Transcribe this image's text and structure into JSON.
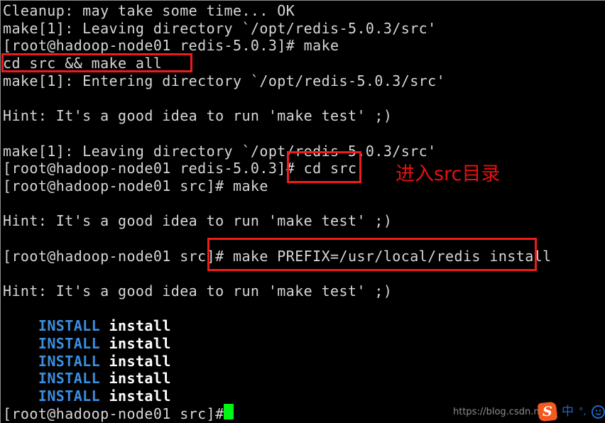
{
  "terminal": {
    "lines": [
      {
        "id": "line-cleanup",
        "text": "Cleanup: may take some time... OK"
      },
      {
        "id": "line-leaving-1",
        "text": "make[1]: Leaving directory `/opt/redis-5.0.3/src'"
      },
      {
        "id": "line-prompt-make",
        "text": "[root@hadoop-node01 redis-5.0.3]# make"
      },
      {
        "id": "line-cd-src-make-all",
        "text": "cd src && make all"
      },
      {
        "id": "line-entering-1",
        "text": "make[1]: Entering directory `/opt/redis-5.0.3/src'"
      },
      {
        "id": "line-blank-1",
        "text": ""
      },
      {
        "id": "line-hint-1",
        "text": "Hint: It's a good idea to run 'make test' ;)"
      },
      {
        "id": "line-blank-2",
        "text": ""
      },
      {
        "id": "line-leaving-2",
        "text": "make[1]: Leaving directory `/opt/redis-5.0.3/src'"
      },
      {
        "id": "line-prompt-cd-src",
        "text": "[root@hadoop-node01 redis-5.0.3]# cd src"
      },
      {
        "id": "line-prompt-make-2",
        "text": "[root@hadoop-node01 src]# make"
      },
      {
        "id": "line-blank-3",
        "text": ""
      },
      {
        "id": "line-hint-2",
        "text": "Hint: It's a good idea to run 'make test' ;)"
      },
      {
        "id": "line-blank-4",
        "text": ""
      },
      {
        "id": "line-prompt-install",
        "text": "[root@hadoop-node01 src]# make PREFIX=/usr/local/redis install"
      },
      {
        "id": "line-blank-5",
        "text": ""
      },
      {
        "id": "line-hint-3",
        "text": "Hint: It's a good idea to run 'make test' ;)"
      },
      {
        "id": "line-blank-6",
        "text": ""
      }
    ],
    "install_lines": [
      {
        "id": "install-line-1",
        "indent": "    ",
        "keyword": "INSTALL",
        "target": " install"
      },
      {
        "id": "install-line-2",
        "indent": "    ",
        "keyword": "INSTALL",
        "target": " install"
      },
      {
        "id": "install-line-3",
        "indent": "    ",
        "keyword": "INSTALL",
        "target": " install"
      },
      {
        "id": "install-line-4",
        "indent": "    ",
        "keyword": "INSTALL",
        "target": " install"
      },
      {
        "id": "install-line-5",
        "indent": "    ",
        "keyword": "INSTALL",
        "target": " install"
      }
    ],
    "final_prompt": "[root@hadoop-node01 src]# ",
    "colors": {
      "background": "#000000",
      "foreground": "#d6d6d6",
      "install_keyword": "#3a8fe0",
      "install_target": "#ffffff",
      "cursor": "#00f516",
      "annotation": "#ef1b1b"
    }
  },
  "annotations": {
    "box_cd_src_make_all_label": "cd src && make all",
    "box_cd_src_label": "cd src",
    "box_make_prefix_label": "make PREFIX=/usr/local/redis install",
    "note_enter_src_dir": "进入src目录"
  },
  "watermark": {
    "url": "https://blog.csdn.net/"
  },
  "ime": {
    "logo_letter": "S",
    "language_mode": "中",
    "punctuation_mode": "°,",
    "emoji_label": "smiley"
  }
}
